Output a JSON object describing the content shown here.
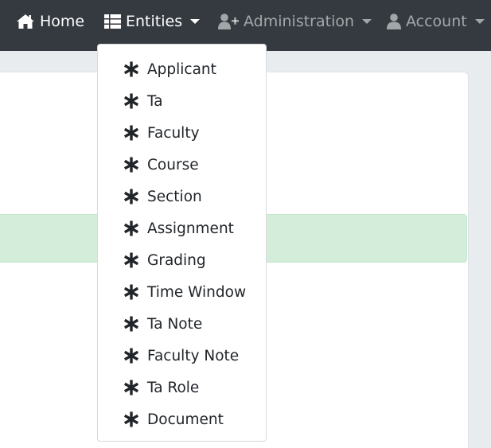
{
  "navbar": {
    "home_label": "Home",
    "entities_label": "Entities",
    "administration_label": "Administration",
    "account_label": "Account"
  },
  "entities_menu": {
    "items": [
      {
        "label": "Applicant",
        "icon": "asterisk-icon"
      },
      {
        "label": "Ta",
        "icon": "asterisk-icon"
      },
      {
        "label": "Faculty",
        "icon": "asterisk-icon"
      },
      {
        "label": "Course",
        "icon": "asterisk-icon"
      },
      {
        "label": "Section",
        "icon": "asterisk-icon"
      },
      {
        "label": "Assignment",
        "icon": "asterisk-icon"
      },
      {
        "label": "Grading",
        "icon": "asterisk-icon"
      },
      {
        "label": "Time Window",
        "icon": "asterisk-icon"
      },
      {
        "label": "Ta Note",
        "icon": "asterisk-icon"
      },
      {
        "label": "Faculty Note",
        "icon": "asterisk-icon"
      },
      {
        "label": "Ta Role",
        "icon": "asterisk-icon"
      },
      {
        "label": "Document",
        "icon": "asterisk-icon"
      }
    ]
  },
  "colors": {
    "navbar_bg": "#343a40",
    "alert_success_bg": "#d4edda",
    "menu_text": "#212529"
  },
  "icons": {
    "home": "home-icon",
    "entities": "list-icon",
    "administration": "user-plus-icon",
    "account": "user-icon"
  }
}
